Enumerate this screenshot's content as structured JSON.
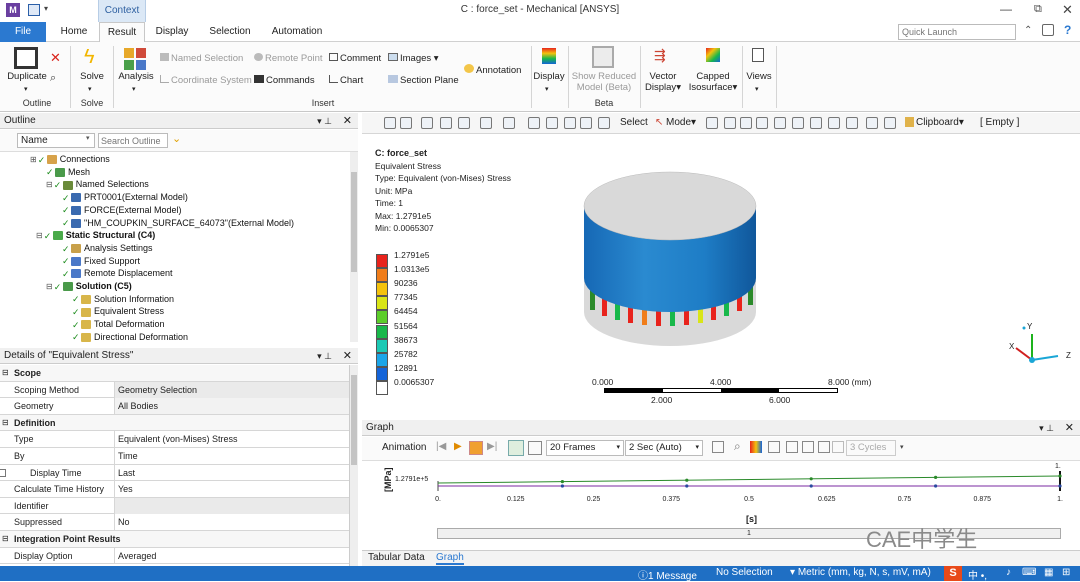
{
  "window": {
    "title": "C : force_set - Mechanical [ANSYS]",
    "quick_launch_placeholder": "Quick Launch"
  },
  "tabs": {
    "context": "Context",
    "file": "File",
    "home": "Home",
    "result": "Result",
    "display": "Display",
    "selection": "Selection",
    "automation": "Automation"
  },
  "ribbon": {
    "duplicate": "Duplicate",
    "outline": "Outline",
    "solve": "Solve",
    "solve_group": "Solve",
    "analysis": "Analysis",
    "named_selection": "Named Selection",
    "remote_point": "Remote Point",
    "comment": "Comment",
    "images": "Images",
    "annotation": "Annotation",
    "coordinate_system": "Coordinate System",
    "commands": "Commands",
    "chart": "Chart",
    "section_plane": "Section Plane",
    "insert": "Insert",
    "display": "Display",
    "show_reduced_1": "Show Reduced",
    "show_reduced_2": "Model (Beta)",
    "beta": "Beta",
    "vector_1": "Vector",
    "vector_2": "Display",
    "capped_1": "Capped",
    "capped_2": "Isosurface",
    "views": "Views"
  },
  "outline": {
    "title": "Outline",
    "name_label": "Name",
    "search_placeholder": "Search Outline",
    "items": [
      {
        "label": "Connections",
        "bold": false
      },
      {
        "label": "Mesh",
        "bold": false
      },
      {
        "label": "Named Selections",
        "bold": false
      },
      {
        "label": "PRT0001(External Model)",
        "bold": false
      },
      {
        "label": "FORCE(External Model)",
        "bold": false
      },
      {
        "label": "\"HM_COUPKIN_SURFACE_64073\"(External Model)",
        "bold": false
      },
      {
        "label": "Static Structural (C4)",
        "bold": true
      },
      {
        "label": "Analysis Settings",
        "bold": false
      },
      {
        "label": "Fixed Support",
        "bold": false
      },
      {
        "label": "Remote Displacement",
        "bold": false
      },
      {
        "label": "Solution (C5)",
        "bold": true
      },
      {
        "label": "Solution Information",
        "bold": false
      },
      {
        "label": "Equivalent Stress",
        "bold": false
      },
      {
        "label": "Total Deformation",
        "bold": false
      },
      {
        "label": "Directional Deformation",
        "bold": false
      }
    ]
  },
  "details": {
    "title": "Details of \"Equivalent Stress\"",
    "rows": [
      {
        "k": "Scope",
        "v": "",
        "section": true
      },
      {
        "k": "Scoping Method",
        "v": "Geometry Selection",
        "section": false
      },
      {
        "k": "Geometry",
        "v": "All Bodies",
        "section": false
      },
      {
        "k": "Definition",
        "v": "",
        "section": true
      },
      {
        "k": "Type",
        "v": "Equivalent (von-Mises) Stress",
        "section": false
      },
      {
        "k": "By",
        "v": "Time",
        "section": false
      },
      {
        "k": "Display Time",
        "v": "Last",
        "section": false
      },
      {
        "k": "Calculate Time History",
        "v": "Yes",
        "section": false
      },
      {
        "k": "Identifier",
        "v": "",
        "section": false
      },
      {
        "k": "Suppressed",
        "v": "No",
        "section": false
      },
      {
        "k": "Integration Point Results",
        "v": "",
        "section": true
      },
      {
        "k": "Display Option",
        "v": "Averaged",
        "section": false
      }
    ]
  },
  "viewer_toolbar": {
    "select": "Select",
    "mode": "Mode",
    "clipboard": "Clipboard",
    "empty": "[ Empty ]"
  },
  "result": {
    "name": "C: force_set",
    "title": "Equivalent Stress",
    "type": "Type: Equivalent (von-Mises) Stress",
    "unit": "Unit: MPa",
    "time": "Time: 1",
    "max": "Max: 1.2791e5",
    "min": "Min: 0.0065307",
    "legend": [
      {
        "label": "1.2791e5",
        "color": "#e8231c"
      },
      {
        "label": "1.0313e5",
        "color": "#f07d1a"
      },
      {
        "label": "90236",
        "color": "#f4c20d"
      },
      {
        "label": "77345",
        "color": "#d9e517"
      },
      {
        "label": "64454",
        "color": "#5ccd2a"
      },
      {
        "label": "51564",
        "color": "#18b84a"
      },
      {
        "label": "38673",
        "color": "#1cc9b4"
      },
      {
        "label": "25782",
        "color": "#1ba5e8"
      },
      {
        "label": "12891",
        "color": "#1464d8"
      },
      {
        "label": "0.0065307",
        "color": "#ffffff"
      }
    ],
    "scale_top": [
      "0.000",
      "4.000",
      "8.000 (mm)"
    ],
    "scale_bottom": [
      "2.000",
      "6.000"
    ],
    "triad": {
      "x": "X",
      "y": "Y",
      "z": "Z"
    }
  },
  "graph": {
    "title": "Graph",
    "animation": "Animation",
    "frames": "20 Frames",
    "speed": "2 Sec (Auto)",
    "cycles": "3 Cycles",
    "ylabel": "[MPa]",
    "yvalue": "1.2791e+5",
    "xlabel": "[s]",
    "xticks": [
      "0.",
      "0.125",
      "0.25",
      "0.375",
      "0.5",
      "0.625",
      "0.75",
      "0.875",
      "1."
    ],
    "end_label": "1.",
    "band_label": "1",
    "tab_tabular": "Tabular Data",
    "tab_graph": "Graph",
    "watermark": "CAE中学生"
  },
  "status": {
    "messages": "1 Message",
    "selection": "No Selection",
    "units": "Metric (mm, kg, N, s, mV, mA)"
  }
}
